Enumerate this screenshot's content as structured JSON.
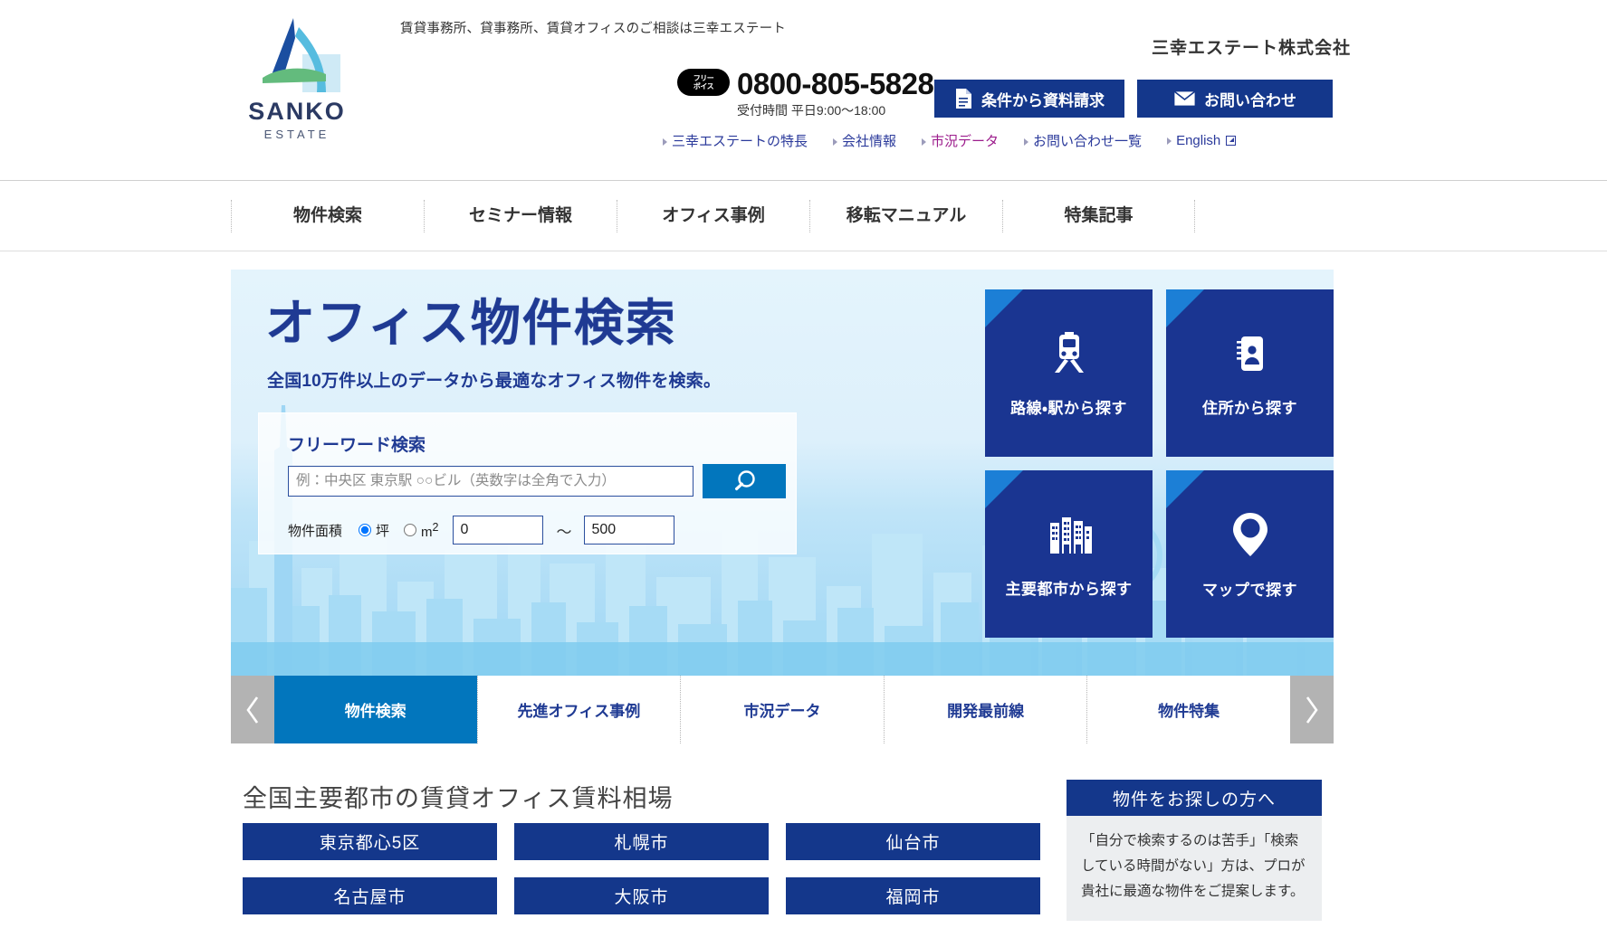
{
  "header": {
    "tagline": "賃貸事務所、貸事務所、賃貸オフィスのご相談は三幸エステート",
    "corp_name": "三幸エステート株式会社",
    "logo": {
      "name": "SANKO",
      "sub": "ESTATE"
    },
    "freedial_line1": "フリー",
    "freedial_line2": "ボイス",
    "tel_number": "0800-805-5828",
    "tel_hours": "受付時間 平日9:00〜18:00",
    "buttons": [
      {
        "label": "条件から資料請求",
        "icon": "document-icon",
        "bg": "#14378b"
      },
      {
        "label": "お問い合わせ",
        "icon": "mail-icon",
        "bg": "#14378b"
      }
    ],
    "util_nav": [
      {
        "label": "三幸エステートの特長",
        "color": "#2b3a9b",
        "external": false
      },
      {
        "label": "会社情報",
        "color": "#2b3a9b",
        "external": false
      },
      {
        "label": "市況データ",
        "color": "#9c1c8c",
        "external": false
      },
      {
        "label": "お問い合わせ一覧",
        "color": "#2b3a9b",
        "external": false
      },
      {
        "label": "English",
        "color": "#2b3a9b",
        "external": true
      }
    ]
  },
  "main_nav": [
    {
      "label": "物件検索"
    },
    {
      "label": "セミナー情報"
    },
    {
      "label": "オフィス事例"
    },
    {
      "label": "移転マニュアル"
    },
    {
      "label": "特集記事"
    }
  ],
  "hero": {
    "title": "オフィス物件検索",
    "subtitle": "全国10万件以上のデータから最適なオフィス物件を検索。",
    "search": {
      "label": "フリーワード検索",
      "placeholder": "例：中央区 東京駅 ○○ビル（英数字は全角で入力）",
      "value": "",
      "submit_icon": "search-icon",
      "area_label": "物件面積",
      "unit_options": [
        {
          "label": "坪",
          "selected": true
        },
        {
          "label": "m2",
          "selected": false
        }
      ],
      "area_min": "0",
      "area_max": "500",
      "range_separator": "〜"
    },
    "tiles": [
      {
        "label": "路線・駅から探す",
        "icon": "train-icon"
      },
      {
        "label": "住所から探す",
        "icon": "address-book-icon"
      },
      {
        "label": "主要都市から探す",
        "icon": "buildings-icon"
      },
      {
        "label": "マップで探す",
        "icon": "map-pin-icon"
      }
    ]
  },
  "carousel": {
    "prev_icon": "chevron-left-icon",
    "next_icon": "chevron-right-icon",
    "tabs": [
      {
        "label": "物件検索",
        "active": true
      },
      {
        "label": "先進オフィス事例",
        "active": false
      },
      {
        "label": "市況データ",
        "active": false
      },
      {
        "label": "開発最前線",
        "active": false
      },
      {
        "label": "物件特集",
        "active": false
      }
    ]
  },
  "bottom": {
    "section_title": "全国主要都市の賃貸オフィス賃料相場",
    "cities": [
      {
        "label": "東京都心5区"
      },
      {
        "label": "札幌市"
      },
      {
        "label": "仙台市"
      },
      {
        "label": "名古屋市"
      },
      {
        "label": "大阪市"
      },
      {
        "label": "福岡市"
      }
    ],
    "side_card": {
      "title": "物件をお探しの方へ",
      "body": "「自分で検索するのは苦手」「検索している時間がない」方は、プロが貴社に最適な物件をご提案します。"
    }
  },
  "colors": {
    "brand_navy": "#14378b",
    "brand_blue": "#0276bd",
    "tile_navy": "#1a3591",
    "tile_accent": "#1c7fd6",
    "link_blue": "#2b3a9b",
    "link_magenta": "#9c1c8c"
  }
}
